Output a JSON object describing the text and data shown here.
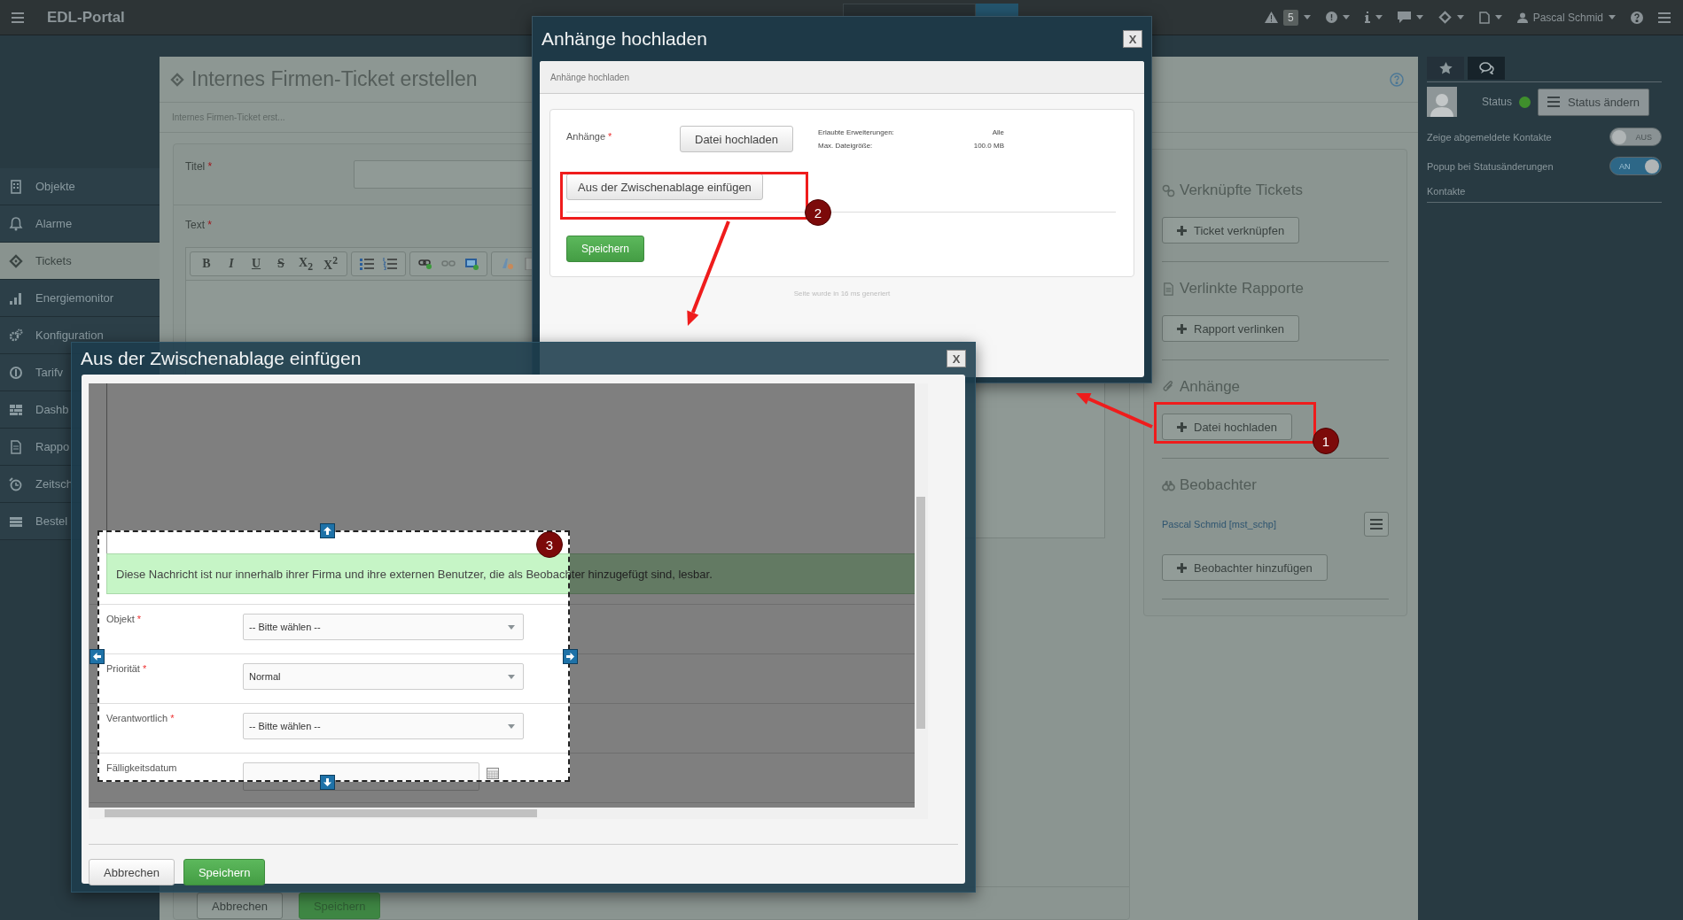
{
  "topbar": {
    "app_title": "EDL-Portal",
    "warning_count": "5",
    "user": "Pascal Schmid"
  },
  "sidebar": {
    "items": [
      {
        "label": "Objekte",
        "selected": false
      },
      {
        "label": "Alarme",
        "selected": false
      },
      {
        "label": "Tickets",
        "selected": true
      },
      {
        "label": "Energiemonitor",
        "selected": false
      },
      {
        "label": "Konfiguration",
        "selected": false
      },
      {
        "label": "Tarifv",
        "selected": false
      },
      {
        "label": "Dashb",
        "selected": false
      },
      {
        "label": "Rappo",
        "selected": false
      },
      {
        "label": "Zeitsch",
        "selected": false
      },
      {
        "label": "Bestel",
        "selected": false
      }
    ]
  },
  "page": {
    "title": "Internes Firmen-Ticket erstellen",
    "breadcrumb": "Internes Firmen-Ticket erst...",
    "fields": [
      {
        "label": "Titel",
        "mark": "*"
      },
      {
        "label": "Text",
        "mark": "*"
      }
    ],
    "format_buttons": [
      "B",
      "I",
      "U",
      "S",
      "X$_{2}$",
      "X$^{2}$"
    ],
    "buttons": [
      {
        "label": "Abbrechen",
        "kind": "default"
      },
      {
        "label": "Speichern",
        "kind": "primary"
      }
    ],
    "sections": [
      {
        "heading": "Verknüpfte Tickets",
        "button": "Ticket verknüpfen"
      },
      {
        "heading": "Verlinkte Rapporte",
        "button": "Rapport verlinken"
      },
      {
        "heading": "Anhänge",
        "button": "Datei hochladen"
      },
      {
        "heading": "Beobachter",
        "watchers": [
          "Pascal Schmid [mst_schp]"
        ],
        "button": "Beobachter hinzufügen"
      }
    ]
  },
  "right_panel": {
    "tabs": [
      {
        "selected": false
      },
      {
        "selected": true
      }
    ],
    "status": {
      "label": "Status",
      "color": "#3f8f2c"
    },
    "status_button": "Status ändern",
    "toggles": [
      {
        "label": "Zeige abgemeldete Kontakte",
        "on": false,
        "state_text": "AUS"
      },
      {
        "label": "Popup bei Statusänderungen",
        "on": true,
        "state_text": "AN"
      }
    ],
    "contacts_heading": "Kontakte"
  },
  "upload_dialog": {
    "title": "Anhänge hochladen",
    "close": "X",
    "panel_title": "Anhänge hochladen",
    "field_label": "Anhänge",
    "mark": "*",
    "upload_button": "Datei hochladen",
    "info": [
      {
        "label": "Erlaubte Erweiterungen:",
        "value": "Alle"
      },
      {
        "label": "Max. Dateigröße:",
        "value": "100.0 MB"
      }
    ],
    "clipboard_button": "Aus der Zwischenablage einfügen",
    "save_button": "Speichern",
    "footer": "Seite wurde in 16 ms generiert"
  },
  "clipboard_dialog": {
    "title": "Aus der Zwischenablage einfügen",
    "close": "X",
    "notice": "Diese Nachricht ist nur innerhalb ihrer Firma und ihre externen Benutzer, die als Beobachter hinzugefügt sind, lesbar.",
    "rows": [
      {
        "label": "Objekt",
        "mark": "*",
        "kind": "select",
        "value": "-- Bitte wählen --"
      },
      {
        "label": "Priorität",
        "mark": "*",
        "kind": "select",
        "value": "Normal"
      },
      {
        "label": "Verantwortlich",
        "mark": "*",
        "kind": "select",
        "value": "-- Bitte wählen --"
      },
      {
        "label": "Fälligkeitsdatum",
        "kind": "date"
      }
    ],
    "buttons": [
      {
        "label": "Abbrechen",
        "kind": "default"
      },
      {
        "label": "Speichern",
        "kind": "primary"
      }
    ]
  },
  "annotations": [
    "1",
    "2",
    "3"
  ]
}
